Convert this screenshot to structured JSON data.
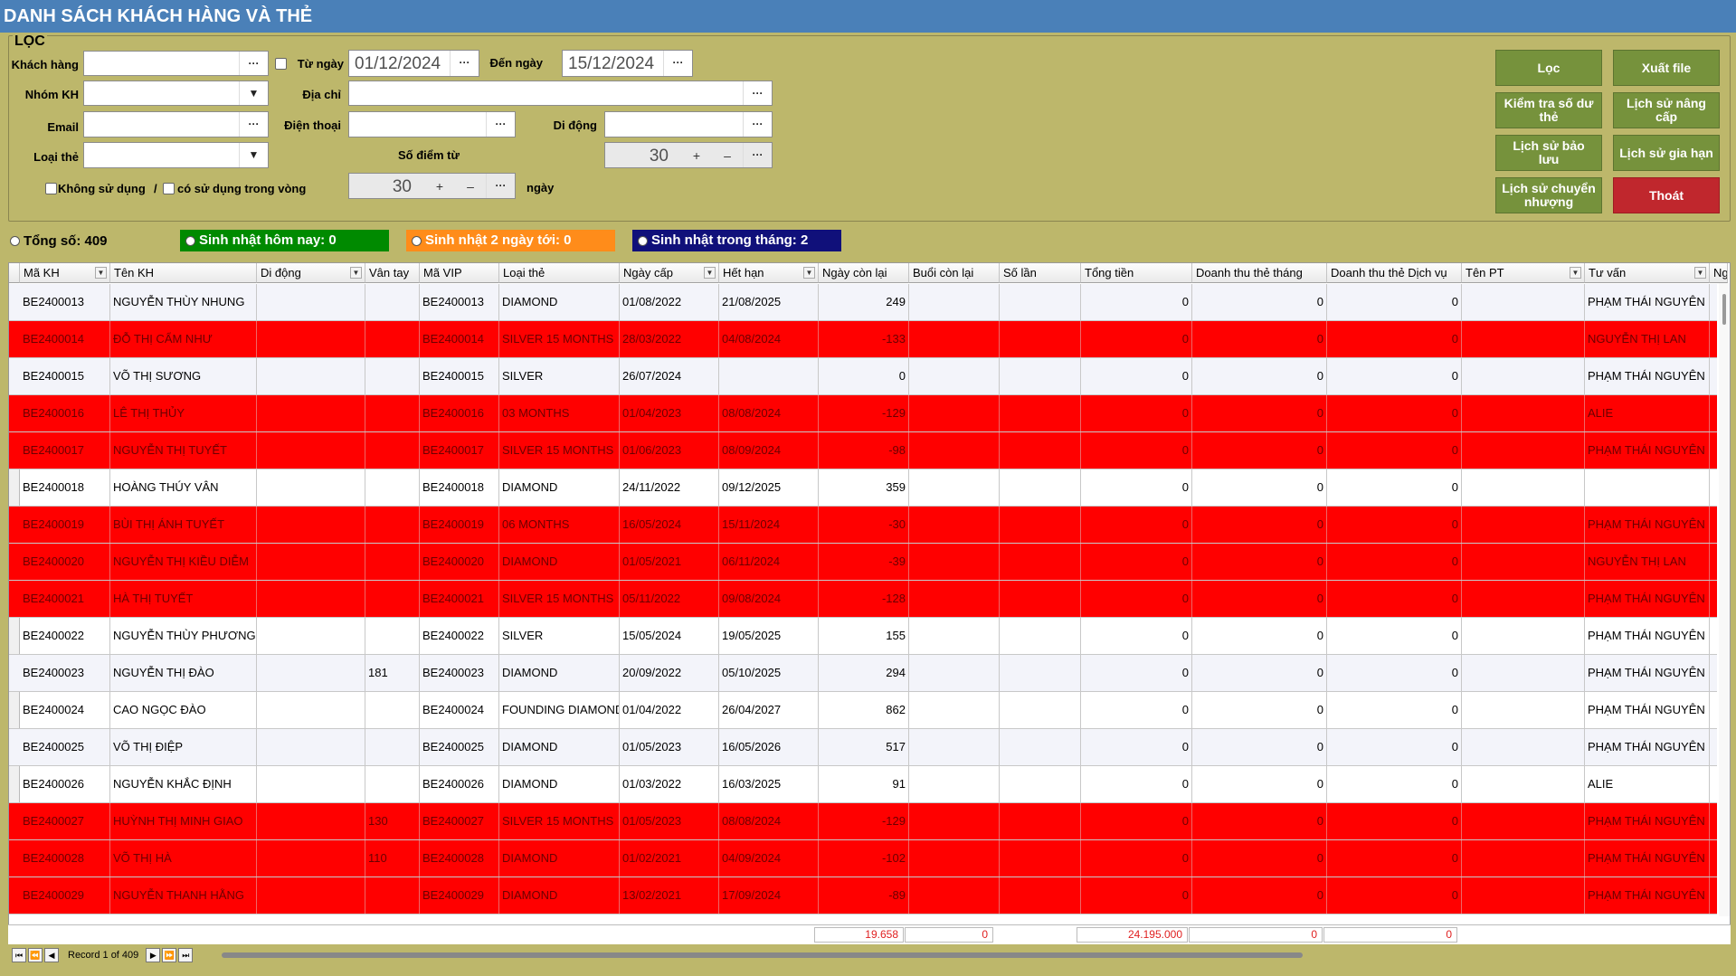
{
  "title": "DANH SÁCH KHÁCH HÀNG VÀ THẺ",
  "filter": {
    "legend": "LỌC",
    "customer_label": "Khách hàng",
    "from_label": "Từ ngày",
    "from_value": "01/12/2024",
    "to_label": "Đến ngày",
    "to_value": "15/12/2024",
    "group_label": "Nhóm KH",
    "address_label": "Địa chỉ",
    "email_label": "Email",
    "phone_label": "Điện thoại",
    "mobile_label": "Di động",
    "card_type_label": "Loại thẻ",
    "points_label": "Số điểm từ",
    "points_value": "30",
    "unused_label": "Không sử dụng",
    "slash": "/",
    "used_within_label": "có sử dụng trong vòng",
    "days_value": "30",
    "days_label": "ngày",
    "ellipsis": "···",
    "plus": "+",
    "minus": "–",
    "arrow": "▼"
  },
  "buttons": {
    "filter": "Lọc",
    "export": "Xuất file",
    "check_balance": "Kiểm tra số dư thẻ",
    "upgrade_history": "Lịch sử nâng cấp",
    "reserve_history": "Lịch sử bảo lưu",
    "extend_history": "Lịch sử gia hạn",
    "transfer_history": "Lịch sử chuyển nhượng",
    "exit": "Thoát"
  },
  "summary": {
    "total": "Tổng số: 409",
    "birthday_today": "Sinh nhật hôm nay: 0",
    "birthday_2days": "Sinh nhật 2 ngày tới: 0",
    "birthday_month": "Sinh nhật trong tháng: 2"
  },
  "colors": {
    "title_bar": "#4a80b8",
    "background": "#bdb76b",
    "button": "#76923c",
    "exit": "#c0272d",
    "today": "#008a00",
    "two_days": "#ff8c1a",
    "month": "#10107a",
    "expired_row": "#ff0000"
  },
  "grid": {
    "columns": [
      "Mã KH",
      "Tên KH",
      "Di động",
      "Vân tay",
      "Mã VIP",
      "Loại thẻ",
      "Ngày cấp",
      "Hết hạn",
      "Ngày còn lại",
      "Buổi còn lại",
      "Số lần",
      "Tổng tiền",
      "Doanh thu thẻ tháng",
      "Doanh thu thẻ Dịch vụ",
      "Tên PT",
      "Tư vấn",
      "Ng"
    ],
    "rows": [
      {
        "status": "alt",
        "cells": [
          "BE2400013",
          "NGUYỄN THÙY NHUNG",
          "",
          "",
          "BE2400013",
          "DIAMOND",
          "01/08/2022",
          "21/08/2025",
          "249",
          "",
          "",
          "0",
          "0",
          "0",
          "",
          "PHẠM THÁI NGUYÊN"
        ]
      },
      {
        "status": "red",
        "cells": [
          "BE2400014",
          "ĐỖ THỊ CẨM NHƯ",
          "",
          "",
          "BE2400014",
          "SILVER 15 MONTHS",
          "28/03/2022",
          "04/08/2024",
          "-133",
          "",
          "",
          "0",
          "0",
          "0",
          "",
          "NGUYỄN THỊ LAN"
        ]
      },
      {
        "status": "alt",
        "cells": [
          "BE2400015",
          "VÕ THỊ SƯƠNG",
          "",
          "",
          "BE2400015",
          "SILVER",
          "26/07/2024",
          "",
          "0",
          "",
          "",
          "0",
          "0",
          "0",
          "",
          "PHẠM THÁI NGUYÊN"
        ]
      },
      {
        "status": "red",
        "cells": [
          "BE2400016",
          "LÊ THỊ THỦY",
          "",
          "",
          "BE2400016",
          "03 MONTHS",
          "01/04/2023",
          "08/08/2024",
          "-129",
          "",
          "",
          "0",
          "0",
          "0",
          "",
          "ALIE"
        ]
      },
      {
        "status": "red",
        "cells": [
          "BE2400017",
          "NGUYỄN THỊ TUYẾT",
          "",
          "",
          "BE2400017",
          "SILVER 15 MONTHS",
          "01/06/2023",
          "08/09/2024",
          "-98",
          "",
          "",
          "0",
          "0",
          "0",
          "",
          "PHẠM THÁI NGUYÊN"
        ]
      },
      {
        "status": "normal",
        "cells": [
          "BE2400018",
          "HOÀNG THÚY VÂN",
          "",
          "",
          "BE2400018",
          "DIAMOND",
          "24/11/2022",
          "09/12/2025",
          "359",
          "",
          "",
          "0",
          "0",
          "0",
          "",
          ""
        ]
      },
      {
        "status": "red",
        "cells": [
          "BE2400019",
          "BÙI THỊ ÁNH TUYẾT",
          "",
          "",
          "BE2400019",
          "06 MONTHS",
          "16/05/2024",
          "15/11/2024",
          "-30",
          "",
          "",
          "0",
          "0",
          "0",
          "",
          "PHẠM THÁI NGUYÊN"
        ]
      },
      {
        "status": "red",
        "cells": [
          "BE2400020",
          "NGUYỄN THỊ KIỀU DIỄM",
          "",
          "",
          "BE2400020",
          "DIAMOND",
          "01/05/2021",
          "06/11/2024",
          "-39",
          "",
          "",
          "0",
          "0",
          "0",
          "",
          "NGUYỄN THỊ LAN"
        ]
      },
      {
        "status": "red",
        "cells": [
          "BE2400021",
          "HÀ THỊ TUYẾT",
          "",
          "",
          "BE2400021",
          "SILVER 15 MONTHS",
          "05/11/2022",
          "09/08/2024",
          "-128",
          "",
          "",
          "0",
          "0",
          "0",
          "",
          "PHẠM THÁI NGUYÊN"
        ]
      },
      {
        "status": "normal",
        "cells": [
          "BE2400022",
          "NGUYỄN THÙY PHƯƠNG",
          "",
          "",
          "BE2400022",
          "SILVER",
          "15/05/2024",
          "19/05/2025",
          "155",
          "",
          "",
          "0",
          "0",
          "0",
          "",
          "PHẠM THÁI NGUYÊN"
        ]
      },
      {
        "status": "alt",
        "cells": [
          "BE2400023",
          "NGUYỄN THỊ ĐÀO",
          "",
          "181",
          "BE2400023",
          "DIAMOND",
          "20/09/2022",
          "05/10/2025",
          "294",
          "",
          "",
          "0",
          "0",
          "0",
          "",
          "PHẠM THÁI NGUYÊN"
        ]
      },
      {
        "status": "normal",
        "cells": [
          "BE2400024",
          "CAO NGỌC ĐÀO",
          "",
          "",
          "BE2400024",
          "FOUNDING DIAMOND",
          "01/04/2022",
          "26/04/2027",
          "862",
          "",
          "",
          "0",
          "0",
          "0",
          "",
          "PHẠM THÁI NGUYÊN"
        ]
      },
      {
        "status": "alt",
        "cells": [
          "BE2400025",
          "VÕ THỊ ĐIỆP",
          "",
          "",
          "BE2400025",
          "DIAMOND",
          "01/05/2023",
          "16/05/2026",
          "517",
          "",
          "",
          "0",
          "0",
          "0",
          "",
          "PHẠM THÁI NGUYÊN"
        ]
      },
      {
        "status": "normal",
        "cells": [
          "BE2400026",
          "NGUYỄN KHẮC ĐỊNH",
          "",
          "",
          "BE2400026",
          "DIAMOND",
          "01/03/2022",
          "16/03/2025",
          "91",
          "",
          "",
          "0",
          "0",
          "0",
          "",
          "ALIE"
        ]
      },
      {
        "status": "red",
        "cells": [
          "BE2400027",
          "HUỲNH THỊ MINH GIAO",
          "",
          "130",
          "BE2400027",
          "SILVER 15 MONTHS",
          "01/05/2023",
          "08/08/2024",
          "-129",
          "",
          "",
          "0",
          "0",
          "0",
          "",
          "PHẠM THÁI NGUYÊN"
        ]
      },
      {
        "status": "red",
        "cells": [
          "BE2400028",
          "VÕ THỊ HÀ",
          "",
          "110",
          "BE2400028",
          "DIAMOND",
          "01/02/2021",
          "04/09/2024",
          "-102",
          "",
          "",
          "0",
          "0",
          "0",
          "",
          "PHẠM THÁI NGUYÊN"
        ]
      },
      {
        "status": "red",
        "cells": [
          "BE2400029",
          "NGUYỄN THANH HẰNG",
          "",
          "",
          "BE2400029",
          "DIAMOND",
          "13/02/2021",
          "17/09/2024",
          "-89",
          "",
          "",
          "0",
          "0",
          "0",
          "",
          "PHẠM THÁI NGUYÊN"
        ]
      }
    ],
    "totals": {
      "days_left": "19.658",
      "sessions_left": "0",
      "total_money": "24.195.000",
      "monthly_revenue": "0",
      "service_revenue": "0"
    }
  },
  "navigator": {
    "record_text": "Record 1 of 409",
    "first": "⏮",
    "prev_page": "⏪",
    "prev": "◀",
    "next": "▶",
    "next_page": "⏩",
    "last": "⏭"
  }
}
